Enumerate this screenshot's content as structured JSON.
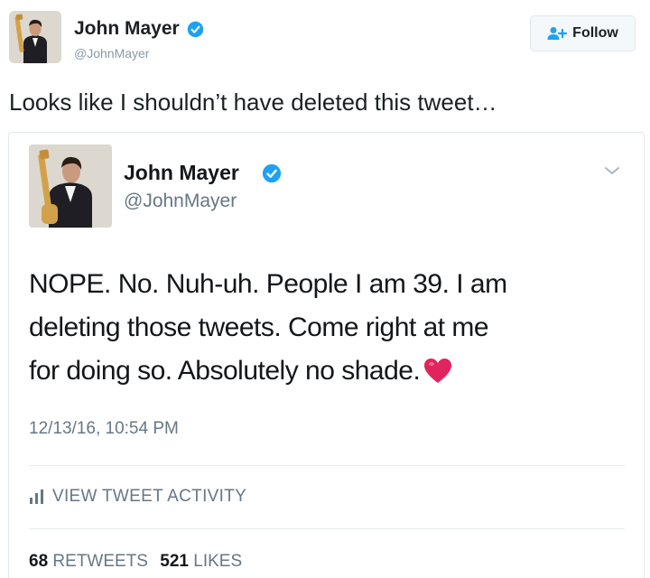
{
  "outer_tweet": {
    "name": "John Mayer",
    "handle": "@JohnMayer",
    "follow_label": "Follow",
    "text": "Looks like I shouldn’t have deleted this tweet…"
  },
  "quoted_tweet": {
    "name": "John Mayer",
    "handle": "@JohnMayer",
    "text_lines": [
      "NOPE. No. Nuh-uh. People I am 39. I am",
      "deleting those tweets. Come right at me",
      "for doing so. Absolutely no shade."
    ],
    "emoji": "heart-emoji",
    "timestamp": "12/13/16, 10:54 PM",
    "activity_label": "VIEW TWEET ACTIVITY",
    "retweets_count": "68",
    "retweets_label": "RETWEETS",
    "likes_count": "521",
    "likes_label": "LIKES"
  },
  "icons": {
    "verified": "verified-badge-icon",
    "follow": "add-user-icon",
    "chevron": "chevron-down-icon",
    "activity": "bar-chart-icon",
    "heart": "heart-icon"
  },
  "colors": {
    "verified_blue": "#1da1f2",
    "text_primary": "#14171a",
    "text_secondary": "#657786",
    "heart_red": "#e0245e",
    "follow_icon_blue": "#1da1f2"
  }
}
